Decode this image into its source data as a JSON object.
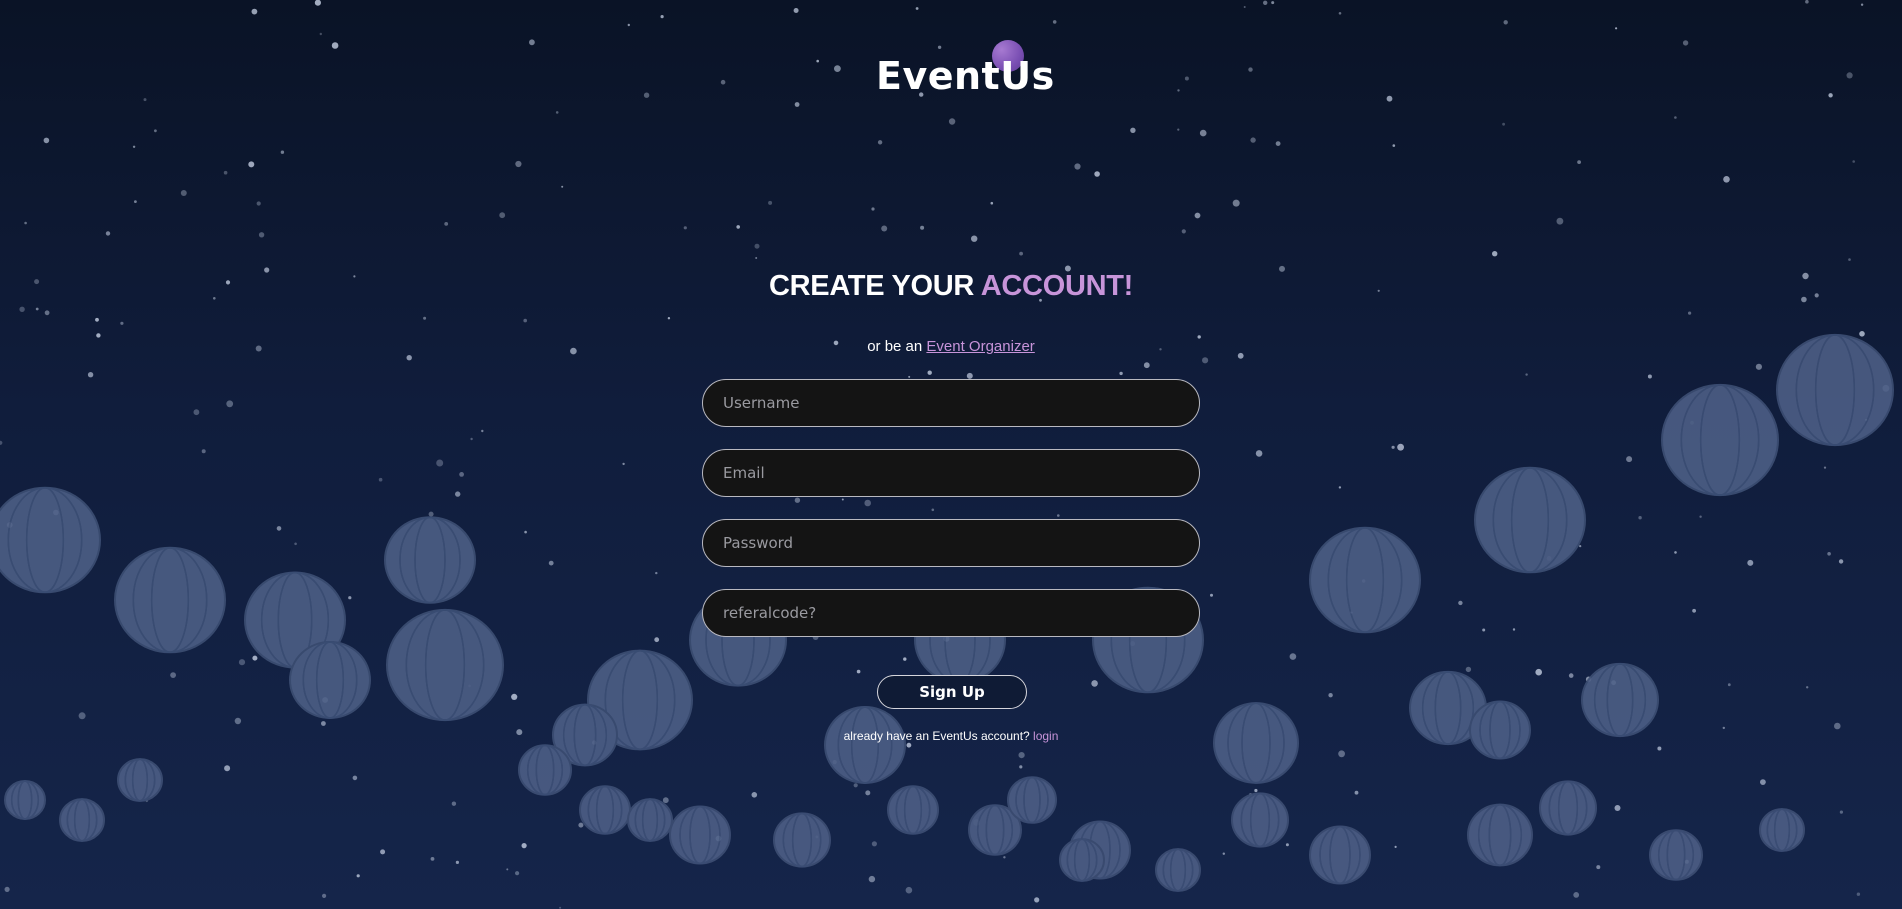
{
  "brand": {
    "name": "EventUs",
    "accent_color": "#c794d9",
    "logo_icon": "moon-circle-icon"
  },
  "heading": {
    "part1": "CREATE YOUR ",
    "part2": "ACCOUNT!"
  },
  "subtitle": {
    "prefix": "or be an ",
    "link": "Event Organizer"
  },
  "form": {
    "username_placeholder": "Username",
    "email_placeholder": "Email",
    "password_placeholder": "Password",
    "referral_placeholder": "referalcode?"
  },
  "signup_label": "Sign Up",
  "login": {
    "prompt": "already have an EventUs account? ",
    "link": "login"
  },
  "background": {
    "image": "night-sky-paper-lanterns",
    "top_color": "#0a1326",
    "bottom_color": "#15254a"
  }
}
